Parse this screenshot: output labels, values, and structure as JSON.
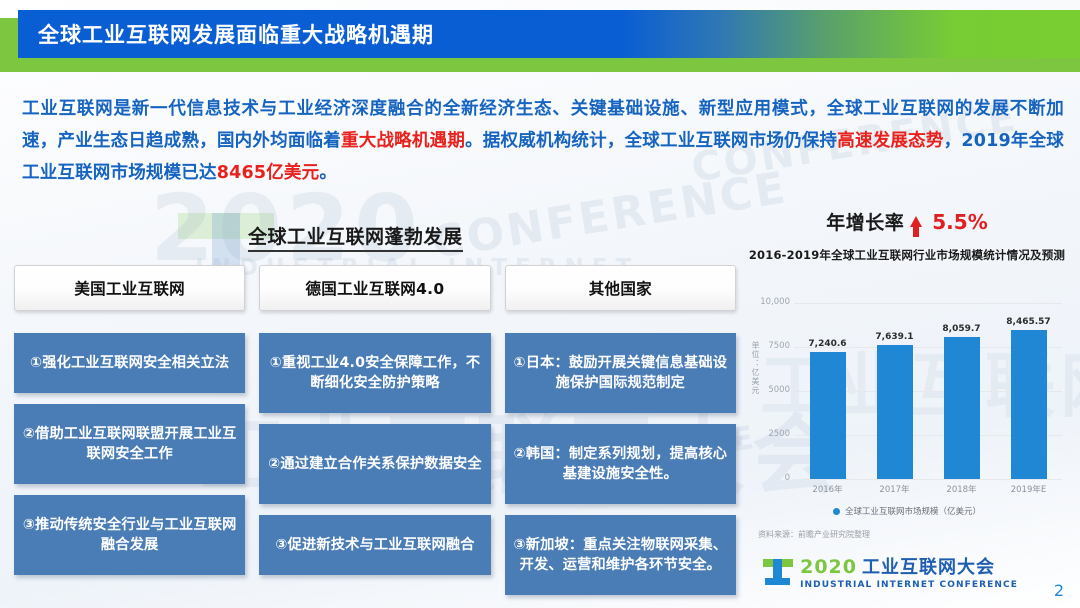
{
  "header": {
    "title": "全球工业互联网发展面临重大战略机遇期",
    "accent_blue": "#0a5ed4",
    "accent_green": "#7dc63f"
  },
  "lead_paragraph": {
    "segments": [
      {
        "text": "工业互联网是新一代信息技术与工业经济深度融合的全新经济生态、关键基础设施、新型应用模式，全球工业互联网的发展不断加速，产业生态日趋成熟，国内外均面临着",
        "highlight": false
      },
      {
        "text": "重大战略机遇期",
        "highlight": true
      },
      {
        "text": "。据权威机构统计，全球工业互联网市场仍保持",
        "highlight": false
      },
      {
        "text": "高速发展态势",
        "highlight": true
      },
      {
        "text": "，2019年全球工业互联网市场规模已达",
        "highlight": false
      },
      {
        "text": "8465亿美元",
        "highlight": true
      },
      {
        "text": "。",
        "highlight": false
      }
    ],
    "text_color": "#1664c0",
    "highlight_color": "#e8211c"
  },
  "section": {
    "title": "全球工业互联网蓬勃发展",
    "columns": [
      {
        "head": "美国工业互联网",
        "items": [
          "①强化工业互联网安全相关立法",
          "②借助工业互联网联盟开展工业互联网安全工作",
          "③推动传统安全行业与工业互联网融合发展"
        ]
      },
      {
        "head": "德国工业互联网4.0",
        "items": [
          "①重视工业4.0安全保障工作，不断细化安全防护策略",
          "②通过建立合作关系保护数据安全",
          "③促进新技术与工业互联网融合"
        ]
      },
      {
        "head": "其他国家",
        "items": [
          "①日本：鼓励开展关键信息基础设施保护国际规范制定",
          "②韩国：制定系列规划，提高核心基建设施安全性。",
          "③新加坡：重点关注物联网采集、开发、运营和维护各环节安全。"
        ]
      }
    ]
  },
  "growth": {
    "label": "年增长率",
    "value": "5.5%",
    "direction": "up",
    "color": "#e02020"
  },
  "chart_data": {
    "type": "bar",
    "title": "2016-2019年全球工业互联网行业市场规模统计情况及预测",
    "categories": [
      "2016年",
      "2017年",
      "2018年",
      "2019年E"
    ],
    "values": [
      7240.6,
      7639.1,
      8059.7,
      8465.57
    ],
    "value_labels": [
      "7,240.6",
      "7,639.1",
      "8,059.7",
      "8,465.57"
    ],
    "series": [
      {
        "name": "全球工业互联网市场规模（亿美元）",
        "values": [
          7240.6,
          7639.1,
          8059.7,
          8465.57
        ],
        "color": "#1f87d4"
      }
    ],
    "ylabel": "单位：亿美元",
    "xlabel": "",
    "ylim": [
      0,
      10000
    ],
    "yticks": [
      0,
      2500,
      5000,
      7500,
      10000
    ],
    "ytick_labels": [
      "0",
      "2500",
      "5000",
      "7500",
      "10,000"
    ],
    "grid": true,
    "legend_position": "bottom",
    "legend": [
      "全球工业互联网市场规模（亿美元）"
    ],
    "source_note": "资料来源：前瞻产业研究院整理"
  },
  "footer": {
    "logo_year": "2020",
    "logo_cn": "工业互联网大会",
    "logo_en": "INDUSTRIAL INTERNET CONFERENCE",
    "page_number": "2"
  },
  "watermarks": {
    "year": "2020",
    "cn": "工业互联网大会",
    "en_industrial": "INDUSTRIAL INTERNET",
    "en_conference": "CONFERENCE"
  }
}
